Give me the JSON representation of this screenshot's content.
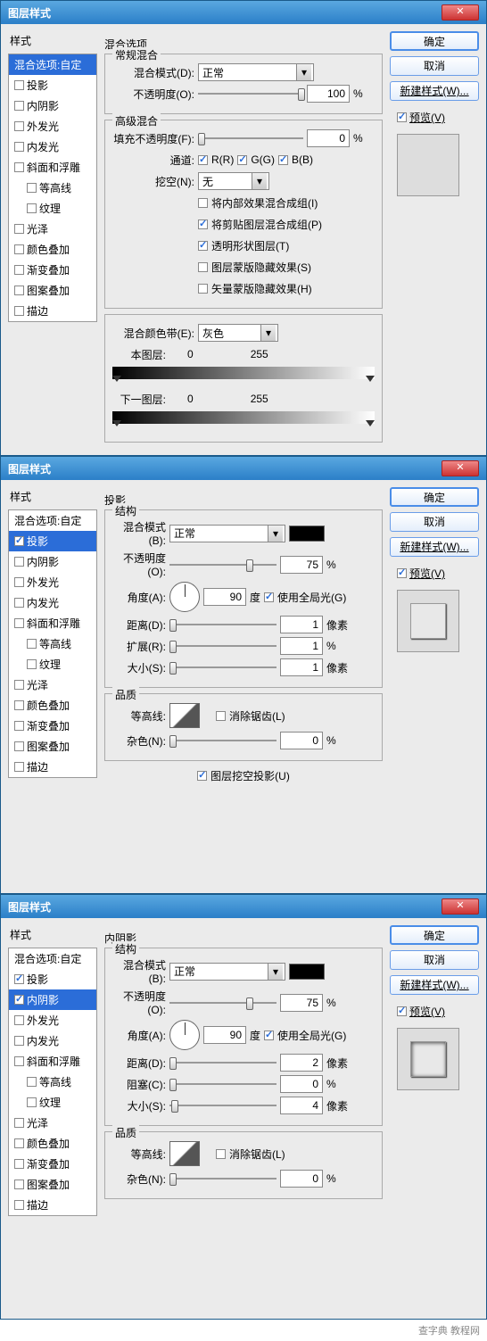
{
  "dialog_title": "图层样式",
  "close_x": "X",
  "sidebar_title": "样式",
  "styles": {
    "blend_options": "混合选项:自定",
    "drop_shadow": "投影",
    "inner_shadow": "内阴影",
    "outer_glow": "外发光",
    "inner_glow": "内发光",
    "bevel": "斜面和浮雕",
    "contour": "等高线",
    "texture": "纹理",
    "satin": "光泽",
    "color_overlay": "颜色叠加",
    "gradient_overlay": "渐变叠加",
    "pattern_overlay": "图案叠加",
    "stroke": "描边"
  },
  "buttons": {
    "ok": "确定",
    "cancel": "取消",
    "new_style": "新建样式(W)...",
    "preview": "预览(V)"
  },
  "d1": {
    "title": "混合选项",
    "general": "常规混合",
    "blend_mode": "混合模式(D):",
    "blend_mode_val": "正常",
    "opacity": "不透明度(O):",
    "opacity_val": "100",
    "percent": "%",
    "advanced": "高级混合",
    "fill_opacity": "填充不透明度(F):",
    "fill_opacity_val": "0",
    "channels": "通道:",
    "ch_r": "R(R)",
    "ch_g": "G(G)",
    "ch_b": "B(B)",
    "knockout": "挖空(N):",
    "knockout_val": "无",
    "kn1": "将内部效果混合成组(I)",
    "kn2": "将剪贴图层混合成组(P)",
    "kn3": "透明形状图层(T)",
    "kn4": "图层蒙版隐藏效果(S)",
    "kn5": "矢量蒙版隐藏效果(H)",
    "blend_if": "混合颜色带(E):",
    "blend_if_val": "灰色",
    "this_layer": "本图层:",
    "underlying": "下一图层:",
    "v0": "0",
    "v255": "255"
  },
  "d2": {
    "title": "投影",
    "structure": "结构",
    "blend_mode": "混合模式(B):",
    "blend_mode_val": "正常",
    "opacity": "不透明度(O):",
    "opacity_val": "75",
    "percent": "%",
    "angle": "角度(A):",
    "angle_val": "90",
    "degree": "度",
    "global_light": "使用全局光(G)",
    "distance": "距离(D):",
    "distance_val": "1",
    "px": "像素",
    "spread": "扩展(R):",
    "spread_val": "1",
    "size": "大小(S):",
    "size_val": "1",
    "quality": "品质",
    "contour": "等高线:",
    "anti_alias": "消除锯齿(L)",
    "noise": "杂色(N):",
    "noise_val": "0",
    "knockout_shadow": "图层挖空投影(U)"
  },
  "d3": {
    "title": "内阴影",
    "structure": "结构",
    "blend_mode": "混合模式(B):",
    "blend_mode_val": "正常",
    "opacity": "不透明度(O):",
    "opacity_val": "75",
    "percent": "%",
    "angle": "角度(A):",
    "angle_val": "90",
    "degree": "度",
    "global_light": "使用全局光(G)",
    "distance": "距离(D):",
    "distance_val": "2",
    "px": "像素",
    "choke": "阻塞(C):",
    "choke_val": "0",
    "size": "大小(S):",
    "size_val": "4",
    "quality": "品质",
    "contour": "等高线:",
    "anti_alias": "消除锯齿(L)",
    "noise": "杂色(N):",
    "noise_val": "0"
  },
  "footer": "查字典 教程网"
}
